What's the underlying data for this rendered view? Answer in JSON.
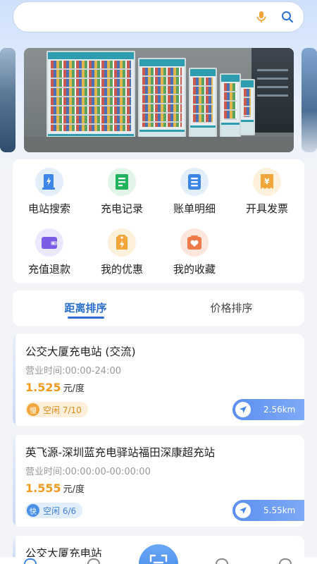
{
  "search": {
    "placeholder": "",
    "value": ""
  },
  "icons": {
    "search_mic": "microphone-icon",
    "search": "search-icon"
  },
  "colors": {
    "accent_blue": "#2a6fcf",
    "price_orange": "#f19a1c",
    "slow_badge_orange": "#f2a53a",
    "fast_badge_blue": "#4a90e8"
  },
  "menu": {
    "items": [
      {
        "label": "电站搜索",
        "icon": "station-search-icon"
      },
      {
        "label": "充电记录",
        "icon": "charge-record-icon"
      },
      {
        "label": "账单明细",
        "icon": "bill-detail-icon"
      },
      {
        "label": "开具发票",
        "icon": "invoice-icon"
      },
      {
        "label": "充值退款",
        "icon": "wallet-icon"
      },
      {
        "label": "我的优惠",
        "icon": "coupon-icon"
      },
      {
        "label": "我的收藏",
        "icon": "favorite-icon"
      }
    ]
  },
  "tabs": [
    {
      "label": "距离排序",
      "active": true
    },
    {
      "label": "价格排序",
      "active": false
    }
  ],
  "stations": [
    {
      "name": "公交大厦充电站 (交流)",
      "hours": "营业时间:00:00-24:00",
      "price": "1.525",
      "unit": "元/度",
      "badge": "慢",
      "status": "空闲 7/10",
      "distance": "2.56km"
    },
    {
      "name": "英飞源-深圳蓝充电驿站福田深康超充站",
      "hours": "营业时间:00:00:00-00:00:00",
      "price": "1.555",
      "unit": "元/度",
      "badge": "快",
      "status": "空闲 6/6",
      "distance": "5.55km"
    },
    {
      "name": "公交大厦充电站"
    }
  ],
  "bottom_nav": {
    "icons": [
      "home-icon",
      "location-icon",
      "scan-icon",
      "charge-icon",
      "profile-icon"
    ]
  }
}
